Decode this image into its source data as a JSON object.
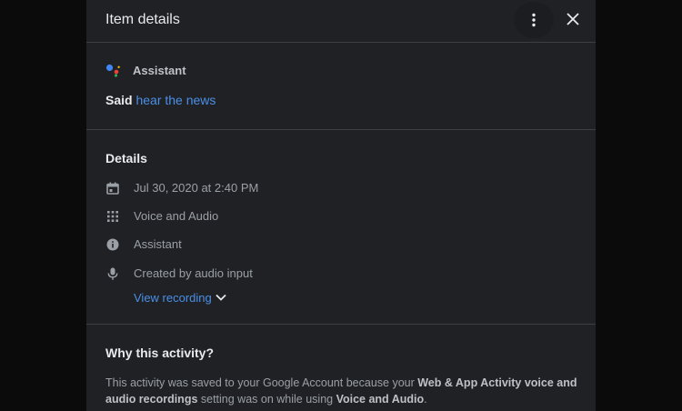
{
  "dialog": {
    "title": "Item details",
    "more_icon": "more-vert-icon",
    "close_icon": "close-icon"
  },
  "activity": {
    "product": "Assistant",
    "product_icon": "google-assistant-icon",
    "said_prefix": "Said",
    "said_query": "hear the news"
  },
  "details": {
    "title": "Details",
    "date": "Jul 30, 2020 at 2:40 PM",
    "product": "Voice and Audio",
    "source": "Assistant",
    "input": "Created by audio input",
    "view_recording_label": "View recording"
  },
  "why": {
    "title": "Why this activity?",
    "text_1": "This activity was saved to your Google Account because your ",
    "bold_1": "Web & App Activity voice and audio recordings",
    "text_2": " setting was on while using ",
    "bold_2": "Voice and Audio",
    "text_3": "."
  },
  "colors": {
    "background": "#202124",
    "link": "#4a8fe7",
    "text_primary": "#e8eaed",
    "text_secondary": "#9aa0a6",
    "divider": "#3c4043"
  }
}
